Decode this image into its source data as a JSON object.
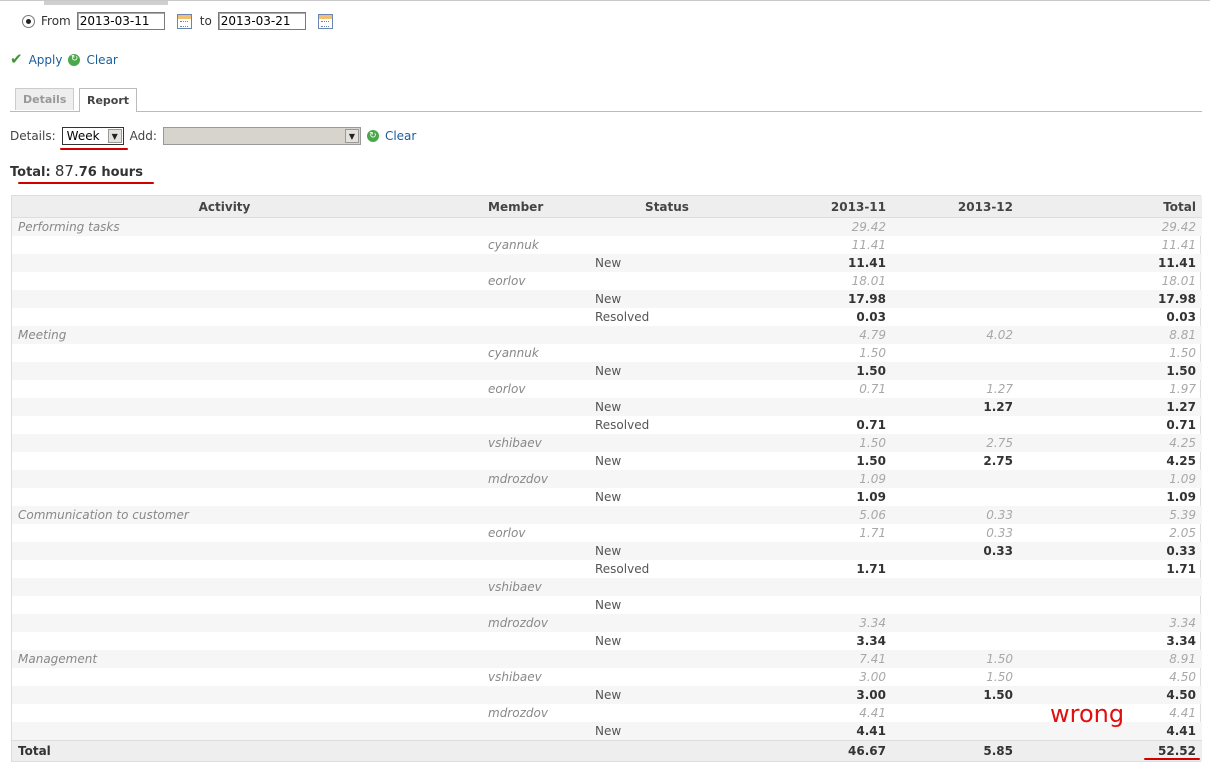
{
  "filter": {
    "from_label": "From",
    "from_value": "2013-03-11",
    "to_label": "to",
    "to_value": "2013-03-21",
    "apply_label": "Apply",
    "clear_label": "Clear"
  },
  "tabs": [
    {
      "label": "Details",
      "active": false
    },
    {
      "label": "Report",
      "active": true
    }
  ],
  "report_options": {
    "details_label": "Details:",
    "details_value": "Week",
    "add_label": "Add:",
    "add_value": "",
    "clear_label": "Clear"
  },
  "total": {
    "label": "Total:",
    "value_main": "87.",
    "value_small": "76 hours"
  },
  "table": {
    "headers": [
      "Activity",
      "Member",
      "Status",
      "2013-11",
      "2013-12",
      "Total"
    ],
    "rows": [
      {
        "level": 0,
        "activity": "Performing tasks",
        "member": "",
        "status": "",
        "c1": "29.42",
        "c2": "",
        "tot": "29.42"
      },
      {
        "level": 1,
        "activity": "",
        "member": "cyannuk",
        "status": "",
        "c1": "11.41",
        "c2": "",
        "tot": "11.41"
      },
      {
        "level": 2,
        "activity": "",
        "member": "",
        "status": "New",
        "c1": "11.41",
        "c2": "",
        "tot": "11.41"
      },
      {
        "level": 1,
        "activity": "",
        "member": "eorlov",
        "status": "",
        "c1": "18.01",
        "c2": "",
        "tot": "18.01"
      },
      {
        "level": 2,
        "activity": "",
        "member": "",
        "status": "New",
        "c1": "17.98",
        "c2": "",
        "tot": "17.98"
      },
      {
        "level": 2,
        "activity": "",
        "member": "",
        "status": "Resolved",
        "c1": "0.03",
        "c2": "",
        "tot": "0.03"
      },
      {
        "level": 0,
        "activity": "Meeting",
        "member": "",
        "status": "",
        "c1": "4.79",
        "c2": "4.02",
        "tot": "8.81"
      },
      {
        "level": 1,
        "activity": "",
        "member": "cyannuk",
        "status": "",
        "c1": "1.50",
        "c2": "",
        "tot": "1.50"
      },
      {
        "level": 2,
        "activity": "",
        "member": "",
        "status": "New",
        "c1": "1.50",
        "c2": "",
        "tot": "1.50"
      },
      {
        "level": 1,
        "activity": "",
        "member": "eorlov",
        "status": "",
        "c1": "0.71",
        "c2": "1.27",
        "tot": "1.97"
      },
      {
        "level": 2,
        "activity": "",
        "member": "",
        "status": "New",
        "c1": "",
        "c2": "1.27",
        "tot": "1.27"
      },
      {
        "level": 2,
        "activity": "",
        "member": "",
        "status": "Resolved",
        "c1": "0.71",
        "c2": "",
        "tot": "0.71"
      },
      {
        "level": 1,
        "activity": "",
        "member": "vshibaev",
        "status": "",
        "c1": "1.50",
        "c2": "2.75",
        "tot": "4.25"
      },
      {
        "level": 2,
        "activity": "",
        "member": "",
        "status": "New",
        "c1": "1.50",
        "c2": "2.75",
        "tot": "4.25"
      },
      {
        "level": 1,
        "activity": "",
        "member": "mdrozdov",
        "status": "",
        "c1": "1.09",
        "c2": "",
        "tot": "1.09"
      },
      {
        "level": 2,
        "activity": "",
        "member": "",
        "status": "New",
        "c1": "1.09",
        "c2": "",
        "tot": "1.09"
      },
      {
        "level": 0,
        "activity": "Communication to customer",
        "member": "",
        "status": "",
        "c1": "5.06",
        "c2": "0.33",
        "tot": "5.39"
      },
      {
        "level": 1,
        "activity": "",
        "member": "eorlov",
        "status": "",
        "c1": "1.71",
        "c2": "0.33",
        "tot": "2.05"
      },
      {
        "level": 2,
        "activity": "",
        "member": "",
        "status": "New",
        "c1": "",
        "c2": "0.33",
        "tot": "0.33"
      },
      {
        "level": 2,
        "activity": "",
        "member": "",
        "status": "Resolved",
        "c1": "1.71",
        "c2": "",
        "tot": "1.71"
      },
      {
        "level": 1,
        "activity": "",
        "member": "vshibaev",
        "status": "",
        "c1": "",
        "c2": "",
        "tot": ""
      },
      {
        "level": 2,
        "activity": "",
        "member": "",
        "status": "New",
        "c1": "",
        "c2": "",
        "tot": ""
      },
      {
        "level": 1,
        "activity": "",
        "member": "mdrozdov",
        "status": "",
        "c1": "3.34",
        "c2": "",
        "tot": "3.34"
      },
      {
        "level": 2,
        "activity": "",
        "member": "",
        "status": "New",
        "c1": "3.34",
        "c2": "",
        "tot": "3.34"
      },
      {
        "level": 0,
        "activity": "Management",
        "member": "",
        "status": "",
        "c1": "7.41",
        "c2": "1.50",
        "tot": "8.91"
      },
      {
        "level": 1,
        "activity": "",
        "member": "vshibaev",
        "status": "",
        "c1": "3.00",
        "c2": "1.50",
        "tot": "4.50"
      },
      {
        "level": 2,
        "activity": "",
        "member": "",
        "status": "New",
        "c1": "3.00",
        "c2": "1.50",
        "tot": "4.50"
      },
      {
        "level": 1,
        "activity": "",
        "member": "mdrozdov",
        "status": "",
        "c1": "4.41",
        "c2": "",
        "tot": "4.41"
      },
      {
        "level": 2,
        "activity": "",
        "member": "",
        "status": "New",
        "c1": "4.41",
        "c2": "",
        "tot": "4.41"
      }
    ],
    "total_row": {
      "label": "Total",
      "c1": "46.67",
      "c2": "5.85",
      "tot": "52.52"
    }
  },
  "annotation": {
    "text": "wrong",
    "color": "#e01010"
  }
}
